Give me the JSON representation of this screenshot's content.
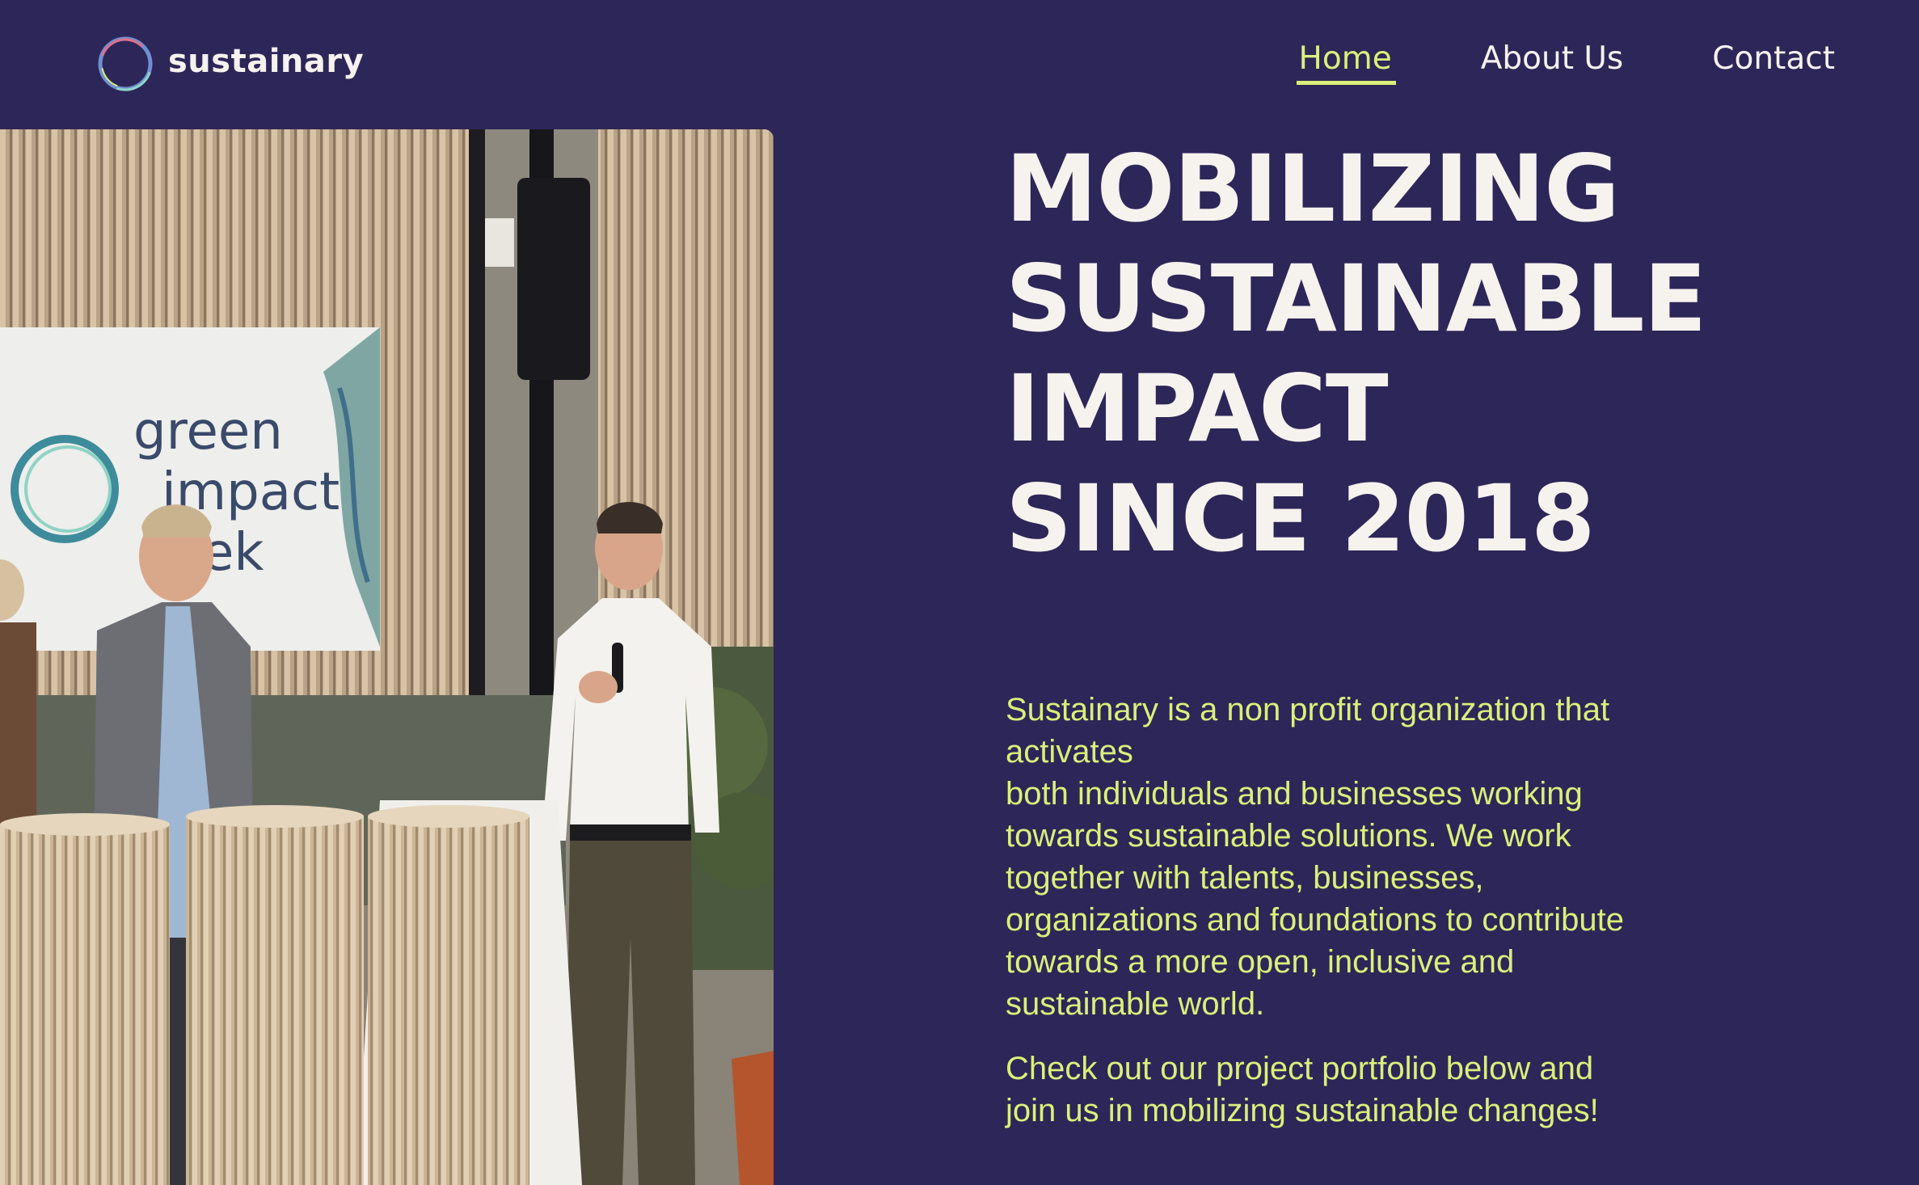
{
  "header": {
    "logo_text": "sustainary",
    "nav": [
      {
        "label": "Home",
        "active": true
      },
      {
        "label": "About Us",
        "active": false
      },
      {
        "label": "Contact",
        "active": false
      }
    ]
  },
  "hero": {
    "title_lines": [
      "MOBILIZING",
      "SUSTAINABLE",
      "IMPACT",
      "SINCE 2018"
    ],
    "paragraph_1_lines": [
      "Sustainary is a non profit organization that",
      "activates",
      "both individuals and businesses working",
      "towards sustainable solutions. We work",
      "together with talents, businesses,",
      "organizations and foundations to contribute",
      "towards a more open, inclusive and",
      "sustainable world."
    ],
    "paragraph_2_lines": [
      "Check out our project portfolio below and",
      "join us in mobilizing sustainable changes!"
    ],
    "photo_banner_text": [
      "green",
      "impact",
      "ek"
    ]
  },
  "colors": {
    "background": "#2d2658",
    "accent": "#d9f07a",
    "heading": "#f6f2ee"
  }
}
